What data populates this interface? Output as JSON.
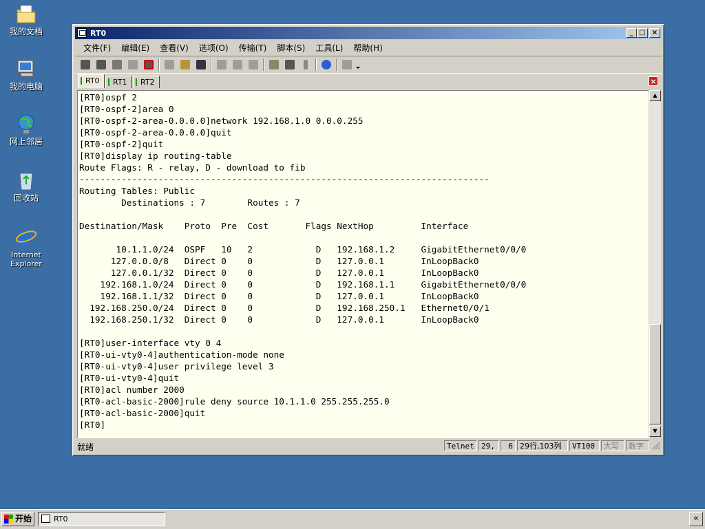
{
  "desktop": {
    "icons": [
      {
        "label": "我的文档",
        "icon": "my-documents-icon"
      },
      {
        "label": "我的电脑",
        "icon": "my-computer-icon"
      },
      {
        "label": "网上邻居",
        "icon": "network-places-icon"
      },
      {
        "label": "回收站",
        "icon": "recycle-bin-icon"
      },
      {
        "label": "Internet Explorer",
        "icon": "internet-explorer-icon"
      }
    ]
  },
  "window": {
    "title": "RT0",
    "controls": {
      "minimize": "_",
      "maximize": "□",
      "close": "×"
    }
  },
  "menu": [
    {
      "label": "文件(F)"
    },
    {
      "label": "编辑(E)"
    },
    {
      "label": "查看(V)"
    },
    {
      "label": "选项(O)"
    },
    {
      "label": "传输(T)"
    },
    {
      "label": "脚本(S)"
    },
    {
      "label": "工具(L)"
    },
    {
      "label": "帮助(H)"
    }
  ],
  "tabs": [
    {
      "label": "RT0",
      "active": true
    },
    {
      "label": "RT1",
      "active": false
    },
    {
      "label": "RT2",
      "active": false
    }
  ],
  "terminal": {
    "lines": [
      "[RT0]ospf 2",
      "[RT0-ospf-2]area 0",
      "[RT0-ospf-2-area-0.0.0.0]network 192.168.1.0 0.0.0.255",
      "[RT0-ospf-2-area-0.0.0.0]quit",
      "[RT0-ospf-2]quit",
      "[RT0]display ip routing-table",
      "Route Flags: R - relay, D - download to fib",
      "------------------------------------------------------------------------------",
      "Routing Tables: Public",
      "        Destinations : 7        Routes : 7",
      "",
      "Destination/Mask    Proto  Pre  Cost       Flags NextHop         Interface",
      "",
      "       10.1.1.0/24  OSPF   10   2            D   192.168.1.2     GigabitEthernet0/0/0",
      "      127.0.0.0/8   Direct 0    0            D   127.0.0.1       InLoopBack0",
      "      127.0.0.1/32  Direct 0    0            D   127.0.0.1       InLoopBack0",
      "    192.168.1.0/24  Direct 0    0            D   192.168.1.1     GigabitEthernet0/0/0",
      "    192.168.1.1/32  Direct 0    0            D   127.0.0.1       InLoopBack0",
      "  192.168.250.0/24  Direct 0    0            D   192.168.250.1   Ethernet0/0/1",
      "  192.168.250.1/32  Direct 0    0            D   127.0.0.1       InLoopBack0",
      "",
      "[RT0]user-interface vty 0 4",
      "[RT0-ui-vty0-4]authentication-mode none",
      "[RT0-ui-vty0-4]user privilege level 3",
      "[RT0-ui-vty0-4]quit",
      "[RT0]acl number 2000",
      "[RT0-acl-basic-2000]rule deny source 10.1.1.0 255.255.255.0",
      "[RT0-acl-basic-2000]quit",
      "[RT0]"
    ]
  },
  "status": {
    "ready": "就绪",
    "protocol": "Telnet",
    "row": "29,",
    "col": "6",
    "size": "29行,103列",
    "emulation": "VT100",
    "caps": "大写",
    "num": "数字"
  },
  "taskbar": {
    "start": "开始",
    "task": "RT0",
    "tray": "«"
  }
}
